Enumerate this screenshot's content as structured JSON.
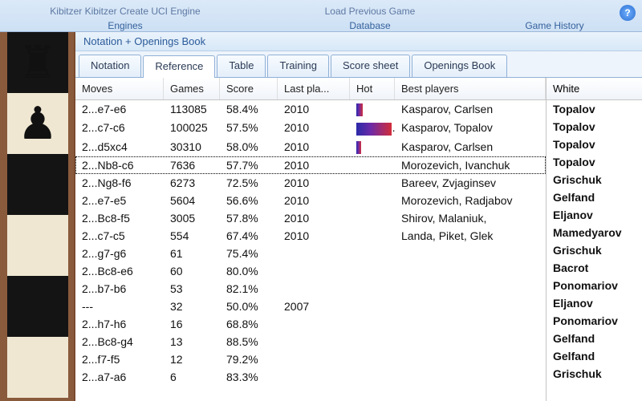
{
  "ribbon": {
    "groups": {
      "engines": {
        "label": "Engines",
        "top": "Kibitzer  Kibitzer        Create UCI Engine"
      },
      "database": {
        "label": "Database",
        "top": "Load Previous Game"
      },
      "history": {
        "label": "Game History",
        "top": ""
      }
    },
    "help_icon": "?"
  },
  "panel": {
    "title": "Notation + Openings Book"
  },
  "tabs": [
    {
      "label": "Notation",
      "active": false
    },
    {
      "label": "Reference",
      "active": true
    },
    {
      "label": "Table",
      "active": false
    },
    {
      "label": "Training",
      "active": false
    },
    {
      "label": "Score sheet",
      "active": false
    },
    {
      "label": "Openings Book",
      "active": false
    }
  ],
  "columns": {
    "moves": "Moves",
    "games": "Games",
    "score": "Score",
    "last": "Last pla...",
    "hot": "Hot",
    "best": "Best players"
  },
  "rows": [
    {
      "move": "2...e7-e6",
      "games": "113085",
      "score": "58.4%",
      "last": "2010",
      "hot": 8,
      "best": "Kasparov, Carlsen"
    },
    {
      "move": "2...c7-c6",
      "games": "100025",
      "score": "57.5%",
      "last": "2010",
      "hot": 44,
      "best": "Kasparov, Topalov"
    },
    {
      "move": "2...d5xc4",
      "games": "30310",
      "score": "58.0%",
      "last": "2010",
      "hot": 6,
      "best": "Kasparov, Carlsen"
    },
    {
      "move": "2...Nb8-c6",
      "games": "7636",
      "score": "57.7%",
      "last": "2010",
      "hot": 0,
      "best": "Morozevich, Ivanchuk",
      "selected": true
    },
    {
      "move": "2...Ng8-f6",
      "games": "6273",
      "score": "72.5%",
      "last": "2010",
      "hot": 0,
      "best": "Bareev, Zvjaginsev"
    },
    {
      "move": "2...e7-e5",
      "games": "5604",
      "score": "56.6%",
      "last": "2010",
      "hot": 0,
      "best": "Morozevich, Radjabov"
    },
    {
      "move": "2...Bc8-f5",
      "games": "3005",
      "score": "57.8%",
      "last": "2010",
      "hot": 0,
      "best": "Shirov, Malaniuk,"
    },
    {
      "move": "2...c7-c5",
      "games": "554",
      "score": "67.4%",
      "last": "2010",
      "hot": 0,
      "best": "Landa, Piket, Glek"
    },
    {
      "move": "2...g7-g6",
      "games": "61",
      "score": "75.4%",
      "last": "",
      "hot": 0,
      "best": ""
    },
    {
      "move": "2...Bc8-e6",
      "games": "60",
      "score": "80.0%",
      "last": "",
      "hot": 0,
      "best": ""
    },
    {
      "move": "2...b7-b6",
      "games": "53",
      "score": "82.1%",
      "last": "",
      "hot": 0,
      "best": ""
    },
    {
      "move": "---",
      "games": "32",
      "score": "50.0%",
      "last": "2007",
      "hot": 0,
      "best": ""
    },
    {
      "move": "2...h7-h6",
      "games": "16",
      "score": "68.8%",
      "last": "",
      "hot": 0,
      "best": ""
    },
    {
      "move": "2...Bc8-g4",
      "games": "13",
      "score": "88.5%",
      "last": "",
      "hot": 0,
      "best": ""
    },
    {
      "move": "2...f7-f5",
      "games": "12",
      "score": "79.2%",
      "last": "",
      "hot": 0,
      "best": ""
    },
    {
      "move": "2...a7-a6",
      "games": "6",
      "score": "83.3%",
      "last": "",
      "hot": 0,
      "best": ""
    }
  ],
  "side": {
    "header": "White",
    "players": [
      "Topalov",
      "Topalov",
      "Topalov",
      "Topalov",
      "Grischuk",
      "Gelfand",
      "Eljanov",
      "Mamedyarov",
      "Grischuk",
      "Bacrot",
      "Ponomariov",
      "Eljanov",
      "Ponomariov",
      "Gelfand",
      "Gelfand",
      "Grischuk"
    ]
  }
}
